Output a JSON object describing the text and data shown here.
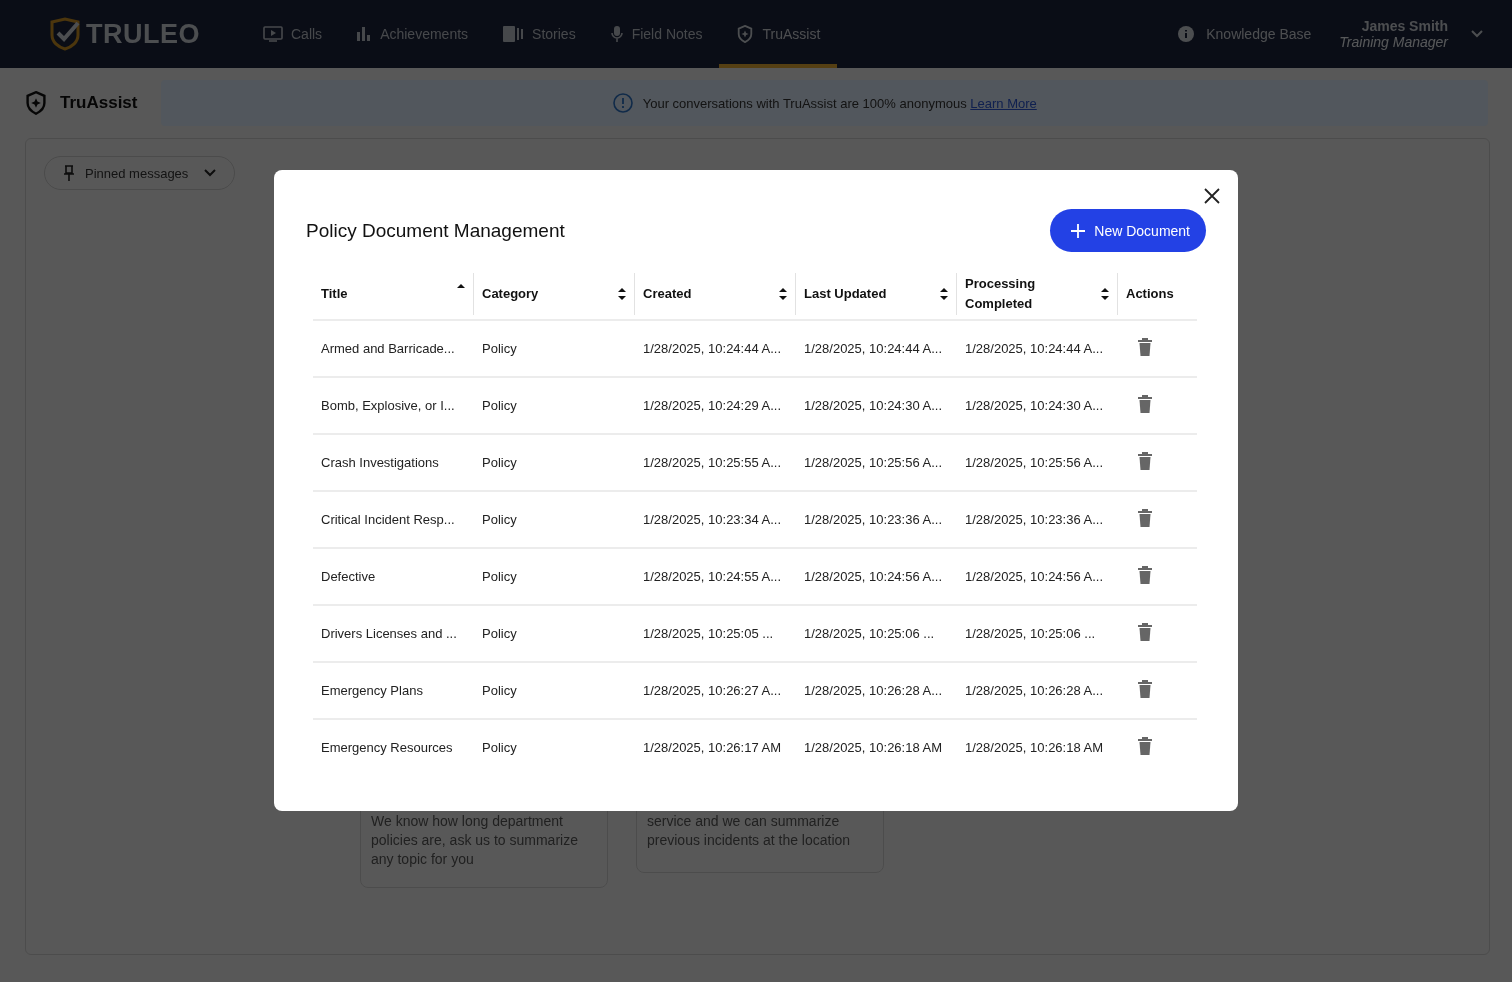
{
  "nav": {
    "logo": "TRULEO",
    "tabs": [
      {
        "label": "Calls",
        "selected": false
      },
      {
        "label": "Achievements",
        "selected": false
      },
      {
        "label": "Stories",
        "selected": false
      },
      {
        "label": "Field Notes",
        "selected": false
      },
      {
        "label": "TruAssist",
        "selected": true
      }
    ],
    "knowledge_base": "Knowledge Base",
    "user": {
      "name": "James Smith",
      "role": "Training Manager"
    }
  },
  "page": {
    "title": "TruAssist",
    "banner": {
      "text": "Your conversations with TruAssist are 100% anonymous",
      "link": "Learn More"
    },
    "pinned": "Pinned messages",
    "cards": [
      "We know how long department policies are, ask us to summarize any topic for you",
      "service and we can summarize previous incidents at the location"
    ]
  },
  "modal": {
    "title": "Policy Document Management",
    "new_button": "New Document",
    "columns": [
      {
        "label": "Title",
        "kind": "sorted"
      },
      {
        "label": "Category",
        "kind": "sortable"
      },
      {
        "label": "Created",
        "kind": "sortable"
      },
      {
        "label": "Last Updated",
        "kind": "sortable"
      },
      {
        "label": "Processing Completed",
        "kind": "sortable"
      },
      {
        "label": "Actions",
        "kind": "plain"
      }
    ],
    "rows": [
      [
        "Armed and Barricade...",
        "Policy",
        "1/28/2025, 10:24:44 A...",
        "1/28/2025, 10:24:44 A...",
        "1/28/2025, 10:24:44 A..."
      ],
      [
        "Bomb, Explosive, or I...",
        "Policy",
        "1/28/2025, 10:24:29 A...",
        "1/28/2025, 10:24:30 A...",
        "1/28/2025, 10:24:30 A..."
      ],
      [
        "Crash Investigations",
        "Policy",
        "1/28/2025, 10:25:55 A...",
        "1/28/2025, 10:25:56 A...",
        "1/28/2025, 10:25:56 A..."
      ],
      [
        "Critical Incident Resp...",
        "Policy",
        "1/28/2025, 10:23:34 A...",
        "1/28/2025, 10:23:36 A...",
        "1/28/2025, 10:23:36 A..."
      ],
      [
        "Defective",
        "Policy",
        "1/28/2025, 10:24:55 A...",
        "1/28/2025, 10:24:56 A...",
        "1/28/2025, 10:24:56 A..."
      ],
      [
        "Drivers Licenses and ...",
        "Policy",
        "1/28/2025, 10:25:05 ...",
        "1/28/2025, 10:25:06 ...",
        "1/28/2025, 10:25:06 ..."
      ],
      [
        "Emergency Plans",
        "Policy",
        "1/28/2025, 10:26:27 A...",
        "1/28/2025, 10:26:28 A...",
        "1/28/2025, 10:26:28 A..."
      ],
      [
        "Emergency Resources",
        "Policy",
        "1/28/2025, 10:26:17 AM",
        "1/28/2025, 10:26:18 AM",
        "1/28/2025, 10:26:18 AM"
      ]
    ]
  }
}
